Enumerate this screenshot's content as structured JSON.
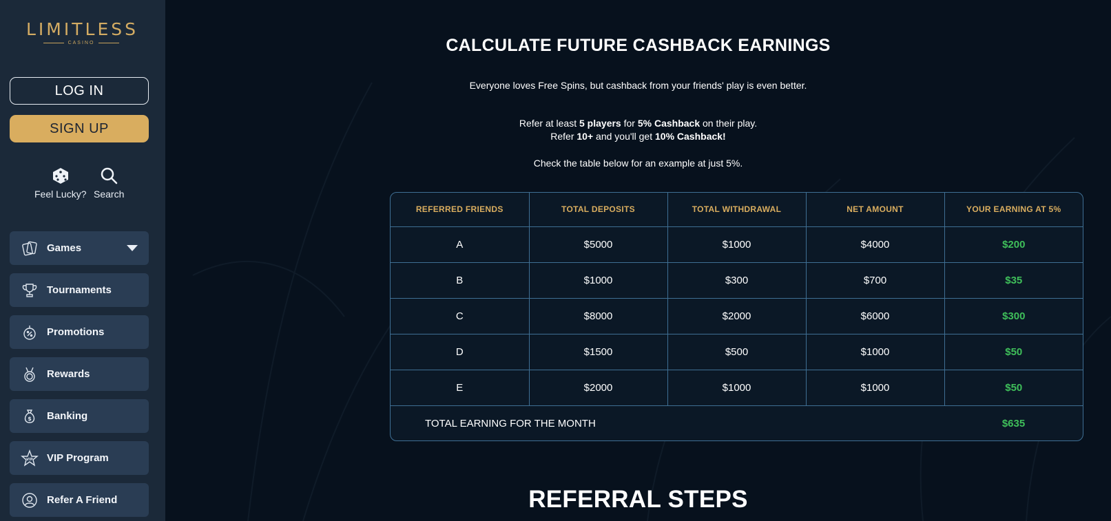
{
  "brand": {
    "name": "LIMITLESS",
    "sub": "CASINO",
    "gold": "#d9ad5f"
  },
  "auth": {
    "login_label": "LOG IN",
    "signup_label": "SIGN UP"
  },
  "quick_actions": [
    {
      "label": "Feel Lucky?",
      "icon": "dice-icon"
    },
    {
      "label": "Search",
      "icon": "search-icon"
    }
  ],
  "nav": [
    {
      "label": "Games",
      "icon": "cards-icon",
      "has_dropdown": true
    },
    {
      "label": "Tournaments",
      "icon": "trophy-icon"
    },
    {
      "label": "Promotions",
      "icon": "percent-badge-icon"
    },
    {
      "label": "Rewards",
      "icon": "medal-icon"
    },
    {
      "label": "Banking",
      "icon": "money-bag-icon"
    },
    {
      "label": "VIP Program",
      "icon": "vip-star-icon"
    },
    {
      "label": "Refer A Friend",
      "icon": "user-circle-icon"
    }
  ],
  "main": {
    "heading": "CALCULATE FUTURE CASHBACK EARNINGS",
    "intro": "Everyone loves Free Spins, but cashback from your friends' play is even better.",
    "rule1_a": "Refer at least ",
    "rule1_b": "5 players",
    "rule1_c": " for ",
    "rule1_d": "5% Cashback",
    "rule1_e": " on their play.",
    "rule2_a": "Refer ",
    "rule2_b": "10+",
    "rule2_c": " and you'll get ",
    "rule2_d": "10% Cashback!",
    "note": "Check the table below for an example at just 5%.",
    "steps_heading": "REFERRAL STEPS"
  },
  "table": {
    "headers": [
      "REFERRED FRIENDS",
      "TOTAL DEPOSITS",
      "TOTAL WITHDRAWAL",
      "NET AMOUNT",
      "YOUR EARNING AT 5%"
    ],
    "rows": [
      [
        "A",
        "$5000",
        "$1000",
        "$4000",
        "$200"
      ],
      [
        "B",
        "$1000",
        "$300",
        "$700",
        "$35"
      ],
      [
        "C",
        "$8000",
        "$2000",
        "$6000",
        "$300"
      ],
      [
        "D",
        "$1500",
        "$500",
        "$1000",
        "$50"
      ],
      [
        "E",
        "$2000",
        "$1000",
        "$1000",
        "$50"
      ]
    ],
    "total_label": "TOTAL EARNING FOR THE MONTH",
    "total_value": "$635",
    "earn_color": "#3fbf5a"
  }
}
